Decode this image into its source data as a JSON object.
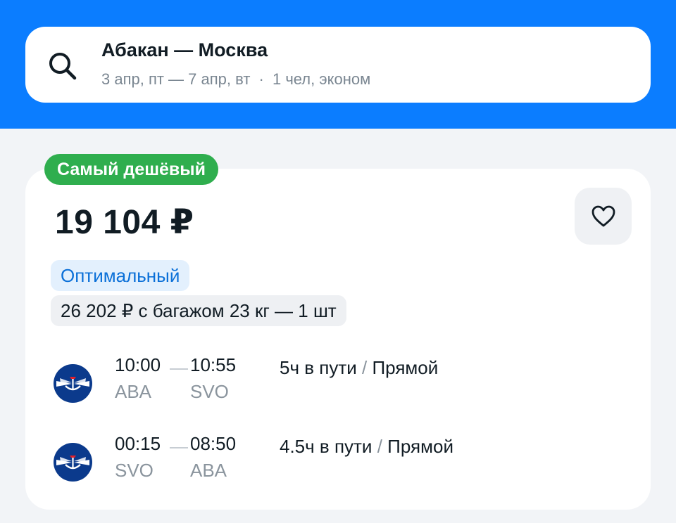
{
  "search": {
    "route": "Абакан — Москва",
    "dates": "3 апр, пт — 7 апр, вт",
    "dot": "·",
    "passengers": "1 чел, эконом",
    "icon": "search-icon"
  },
  "offer": {
    "badge": "Самый дешёвый",
    "price": "19 104 ₽",
    "favorite_icon": "heart-icon",
    "tariff_tag": "Оптимальный",
    "baggage_tag": "26 202 ₽ с багажом 23 кг — 1 шт",
    "legs": [
      {
        "depart_time": "10:00",
        "arrive_time": "10:55",
        "from": "ABA",
        "to": "SVO",
        "duration": "5ч в пути",
        "separator": "/",
        "type": "Прямой",
        "airline_icon": "aeroflot-logo-icon"
      },
      {
        "depart_time": "00:15",
        "arrive_time": "08:50",
        "from": "SVO",
        "to": "ABA",
        "duration": "4.5ч в пути",
        "separator": "/",
        "type": "Прямой",
        "airline_icon": "aeroflot-logo-icon"
      }
    ]
  },
  "colors": {
    "header_blue": "#0b7dff",
    "badge_green": "#2fae4e",
    "tariff_blue": "#0b70d8",
    "airline_navy": "#0b3a8c"
  }
}
